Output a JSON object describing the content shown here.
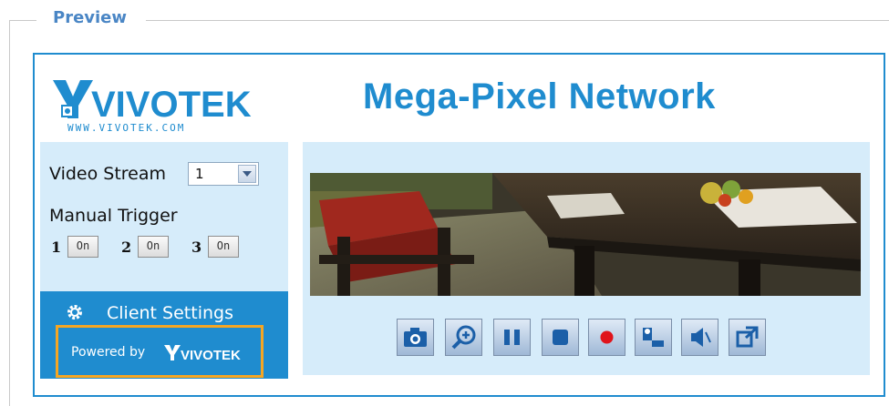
{
  "preview": {
    "legend": "Preview"
  },
  "header": {
    "logo_text": "VIVOTEK",
    "logo_url_text": "WWW.VIVOTEK.COM",
    "title": "Mega-Pixel Network"
  },
  "left_panel": {
    "video_stream_label": "Video Stream",
    "video_stream_value": "1",
    "manual_trigger_label": "Manual Trigger",
    "triggers": [
      {
        "number": "1",
        "button": "On"
      },
      {
        "number": "2",
        "button": "On"
      },
      {
        "number": "3",
        "button": "On"
      }
    ],
    "client_settings_label": "Client Settings",
    "powered_by": "Powered by",
    "powered_logo_text": "VIVOTEK"
  },
  "controls": [
    {
      "icon": "camera-icon"
    },
    {
      "icon": "zoom-in-icon"
    },
    {
      "icon": "pause-icon"
    },
    {
      "icon": "stop-icon"
    },
    {
      "icon": "record-icon"
    },
    {
      "icon": "talk-icon"
    },
    {
      "icon": "speaker-mute-icon"
    },
    {
      "icon": "fullscreen-icon"
    }
  ],
  "colors": {
    "accent": "#1f8ccf",
    "panel_bg": "#d6ecfa",
    "highlight_border": "#f5a623",
    "record_red": "#e0141b"
  }
}
